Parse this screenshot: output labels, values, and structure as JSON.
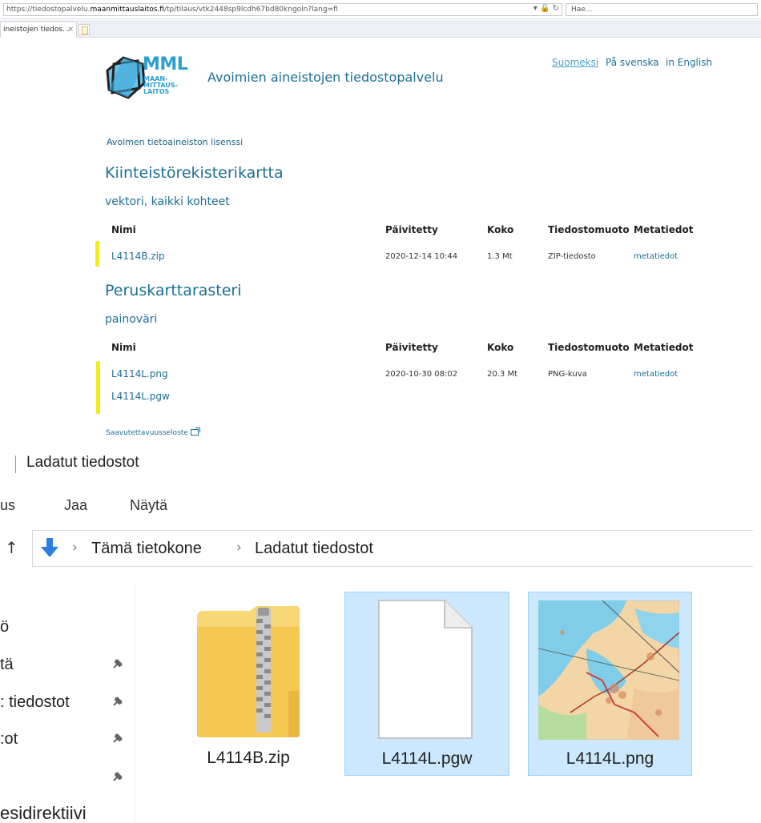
{
  "browser": {
    "url_prefix": "https://tiedostopalvelu.",
    "url_host": "maanmittauslaitos.fi",
    "url_path": "/tp/tilaus/vtk2448sp9lcdh67bd80kngoln?lang=fi",
    "search_placeholder": "Hae...",
    "tab_title": "ineistojen tiedos...",
    "tab_close": "×"
  },
  "header": {
    "logo_text": "MML",
    "logo_sub": "MAAN-\nMITTAUS-\nLAITOS",
    "service_title": "Avoimien aineistojen tiedostopalvelu",
    "languages": [
      "Suomeksi",
      "På svenska",
      "in English"
    ]
  },
  "license_link": "Avoimen tietoaineiston lisenssi",
  "datasets": [
    {
      "title": "Kiinteistörekisterikartta",
      "subtitle": "vektori, kaikki kohteet",
      "columns": [
        "Nimi",
        "Päivitetty",
        "Koko",
        "Tiedostomuoto",
        "Metatiedot"
      ],
      "files": [
        {
          "name": "L4114B.zip",
          "updated": "2020-12-14 10:44",
          "size": "1.3 Mt",
          "format": "ZIP-tiedosto",
          "meta": "metatiedot"
        }
      ]
    },
    {
      "title": "Peruskarttarasteri",
      "subtitle": "painoväri",
      "columns": [
        "Nimi",
        "Päivitetty",
        "Koko",
        "Tiedostomuoto",
        "Metatiedot"
      ],
      "files": [
        {
          "name": "L4114L.png",
          "updated": "2020-10-30 08:02",
          "size": "20.3 Mt",
          "format": "PNG-kuva",
          "meta": "metatiedot"
        },
        {
          "name": "L4114L.pgw"
        }
      ]
    }
  ],
  "accessibility_link": "Saavutettavuusseloste",
  "explorer": {
    "title": "Ladatut tiedostot",
    "ribbon": [
      "us",
      "Jaa",
      "Näytä"
    ],
    "breadcrumb": [
      "Tämä tietokone",
      "Ladatut tiedostot"
    ],
    "nav_items": [
      "ö",
      "tä",
      ": tiedostot",
      ":ot",
      "",
      "esidirektiivi"
    ],
    "files": [
      {
        "name": "L4114B.zip",
        "icon": "zip-folder-icon",
        "selected": false
      },
      {
        "name": "L4114L.pgw",
        "icon": "blank-document-icon",
        "selected": true
      },
      {
        "name": "L4114L.png",
        "icon": "map-thumbnail-icon",
        "selected": true
      }
    ]
  },
  "colors": {
    "link": "#1b6f94",
    "highlight": "#f2ea1a",
    "selection": "#cce8ff",
    "folder": "#f8d775"
  }
}
